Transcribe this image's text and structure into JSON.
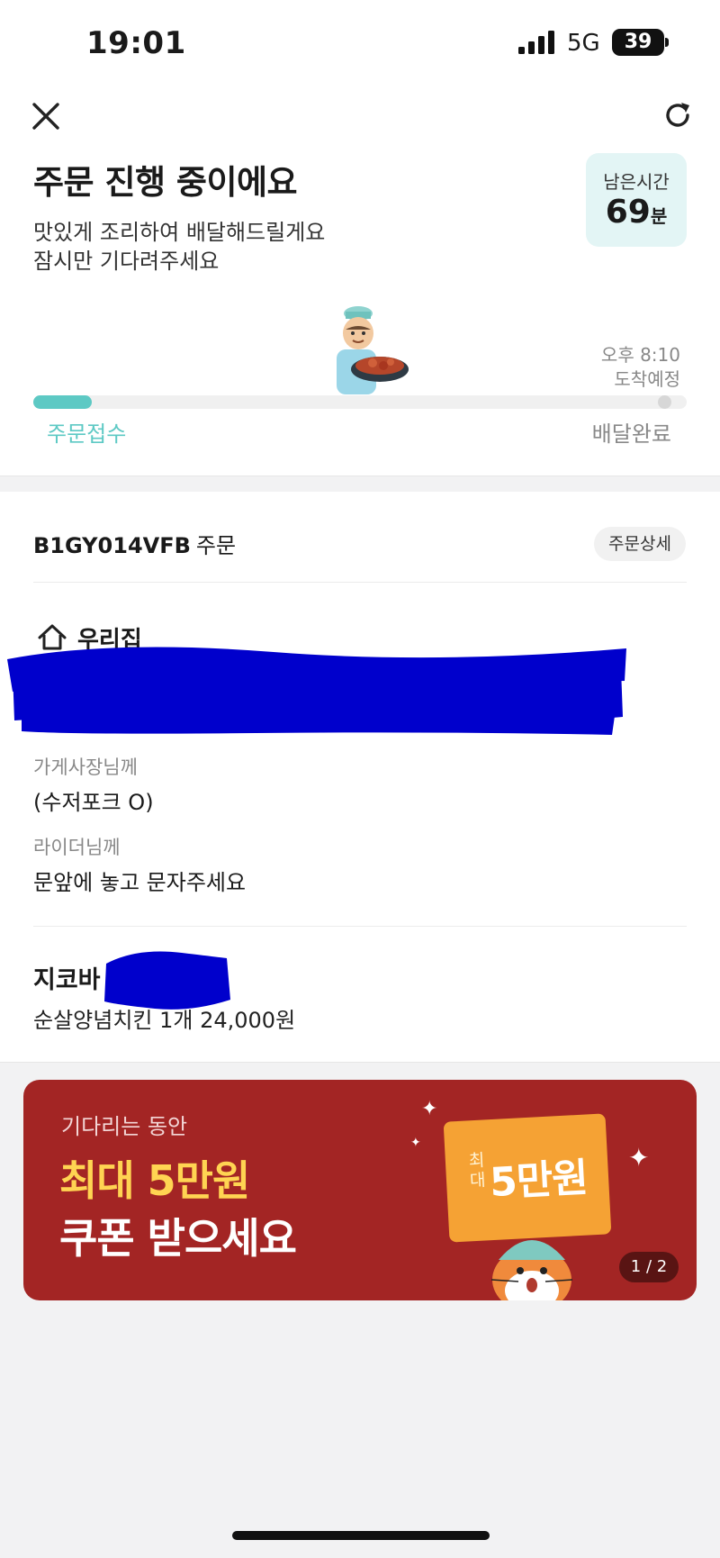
{
  "status_bar": {
    "time": "19:01",
    "network": "5G",
    "battery": "39"
  },
  "header": {
    "title": "주문 진행 중이에요",
    "subtitle_line1": "맛있게 조리하여 배달해드릴게요",
    "subtitle_line2": "잠시만 기다려주세요",
    "remaining_label": "남은시간",
    "remaining_value": "69",
    "remaining_unit": "분"
  },
  "progress": {
    "eta_time": "오후 8:10",
    "eta_label": "도착예정",
    "step_start": "주문접수",
    "step_end": "배달완료",
    "fraction": 0.09
  },
  "order": {
    "id": "B1GY014VFB",
    "id_suffix": "주문",
    "detail_button": "주문상세",
    "address_title": "우리집",
    "owner_label": "가게사장님께",
    "owner_request": "(수저포크 O)",
    "rider_label": "라이더님께",
    "rider_request": "문앞에 놓고 문자주세요",
    "store_name": "지코바",
    "item_line": "순살양념치킨 1개 24,000원"
  },
  "banner": {
    "line1": "기다리는 동안",
    "line2": "최대 5만원",
    "line3": "쿠폰 받으세요",
    "ticket_small": "최대",
    "ticket_big": "5만원",
    "page_indicator": "1 / 2"
  },
  "colors": {
    "accent": "#5dc9c4",
    "banner_bg": "#a32524",
    "banner_highlight": "#ffd452",
    "redaction": "#0000cc"
  }
}
